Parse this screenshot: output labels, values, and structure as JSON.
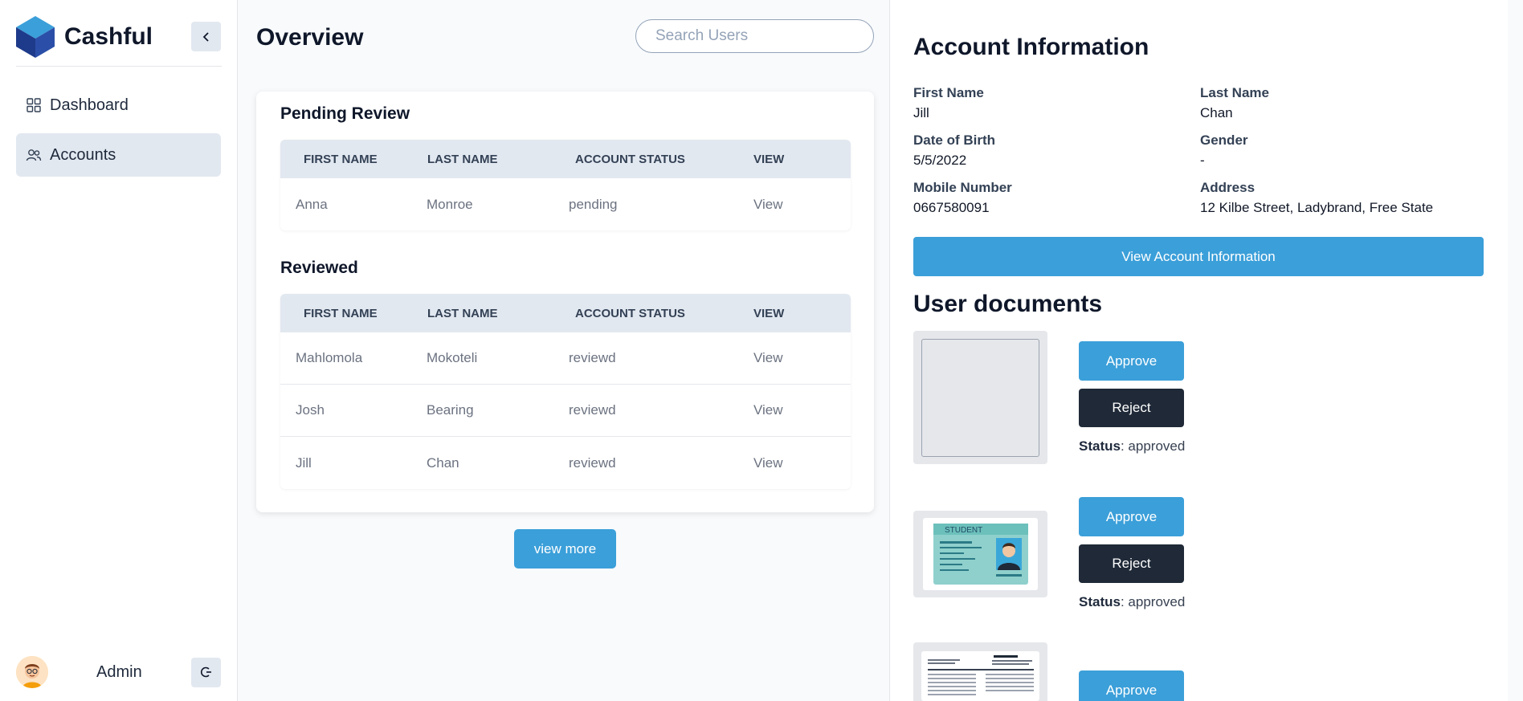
{
  "sidebar": {
    "brand": "Cashful",
    "collapse_icon": "chevron-left-icon",
    "items": [
      {
        "label": "Dashboard",
        "icon": "grid-icon",
        "active": false
      },
      {
        "label": "Accounts",
        "icon": "users-icon",
        "active": true
      }
    ],
    "user": {
      "name": "Admin",
      "logout_icon": "logout-icon"
    }
  },
  "main": {
    "title": "Overview",
    "search_placeholder": "Search Users",
    "pending": {
      "title": "Pending Review",
      "columns": [
        "FIRST NAME",
        "LAST NAME",
        "ACCOUNT STATUS",
        "VIEW"
      ],
      "rows": [
        {
          "first": "Anna",
          "last": "Monroe",
          "status": "pending",
          "view": "View"
        }
      ]
    },
    "reviewed": {
      "title": "Reviewed",
      "columns": [
        "FIRST NAME",
        "LAST NAME",
        "ACCOUNT STATUS",
        "VIEW"
      ],
      "rows": [
        {
          "first": "Mahlomola",
          "last": "Mokoteli",
          "status": "reviewd",
          "view": "View"
        },
        {
          "first": "Josh",
          "last": "Bearing",
          "status": "reviewd",
          "view": "View"
        },
        {
          "first": "Jill",
          "last": "Chan",
          "status": "reviewd",
          "view": "View"
        }
      ]
    },
    "view_more": "view more"
  },
  "account": {
    "title": "Account Information",
    "fields": {
      "first_name": {
        "label": "First Name",
        "value": "Jill"
      },
      "last_name": {
        "label": "Last Name",
        "value": "Chan"
      },
      "dob": {
        "label": "Date of Birth",
        "value": "5/5/2022"
      },
      "gender": {
        "label": "Gender",
        "value": "-"
      },
      "mobile": {
        "label": "Mobile Number",
        "value": "0667580091"
      },
      "address": {
        "label": "Address",
        "value": "12 Kilbe Street, Ladybrand, Free State"
      }
    },
    "view_button": "View Account Information"
  },
  "documents": {
    "title": "User documents",
    "approve_label": "Approve",
    "reject_label": "Reject",
    "status_label": "Status",
    "items": [
      {
        "status": "approved"
      },
      {
        "status": "approved",
        "card_text": "STUDENT"
      },
      {
        "status": ""
      }
    ]
  },
  "colors": {
    "primary": "#3b9fd9",
    "dark": "#1f2937",
    "nav_active": "#e2e8f0",
    "header_bg": "#e2e8f0"
  }
}
